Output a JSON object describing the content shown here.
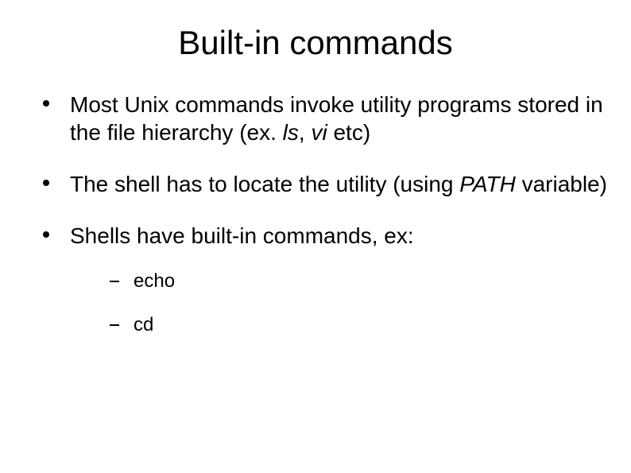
{
  "title": "Built-in commands",
  "bullets": [
    {
      "segments": [
        {
          "text": "Most Unix commands invoke utility programs stored in the file hierarchy (ex. ",
          "italic": false
        },
        {
          "text": "ls",
          "italic": true
        },
        {
          "text": ", ",
          "italic": false
        },
        {
          "text": "vi",
          "italic": true
        },
        {
          "text": " etc)",
          "italic": false
        }
      ]
    },
    {
      "segments": [
        {
          "text": "The shell has to locate the utility (using ",
          "italic": false
        },
        {
          "text": "PATH",
          "italic": true
        },
        {
          "text": " variable)",
          "italic": false
        }
      ]
    },
    {
      "segments": [
        {
          "text": "Shells have built-in commands, ex:",
          "italic": false
        }
      ],
      "sub": [
        {
          "text": "echo"
        },
        {
          "text": "cd"
        }
      ]
    }
  ]
}
